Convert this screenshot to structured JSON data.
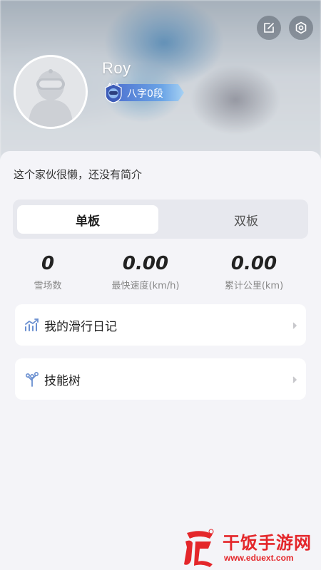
{
  "profile": {
    "username": "Roy",
    "badge_label": "八字0段",
    "bio": "这个家伙很懒，还没有简介"
  },
  "header_icons": {
    "edit": "edit-icon",
    "settings": "settings-icon"
  },
  "tabs": [
    {
      "label": "单板",
      "selected": true
    },
    {
      "label": "双板",
      "selected": false
    }
  ],
  "stats": [
    {
      "value": "0",
      "label": "雪场数"
    },
    {
      "value": "0.00",
      "label": "最快速度(km/h)"
    },
    {
      "value": "0.00",
      "label": "累计公里(km)"
    }
  ],
  "menu": [
    {
      "label": "我的滑行日记",
      "icon": "trend-chart-icon"
    },
    {
      "label": "技能树",
      "icon": "skill-tree-icon"
    }
  ],
  "watermark": {
    "title": "干饭手游网",
    "url": "www.eduext.com"
  },
  "colors": {
    "accent_blue": "#5a86d8",
    "watermark_red": "#e4262a",
    "background": "#f4f4f8"
  }
}
